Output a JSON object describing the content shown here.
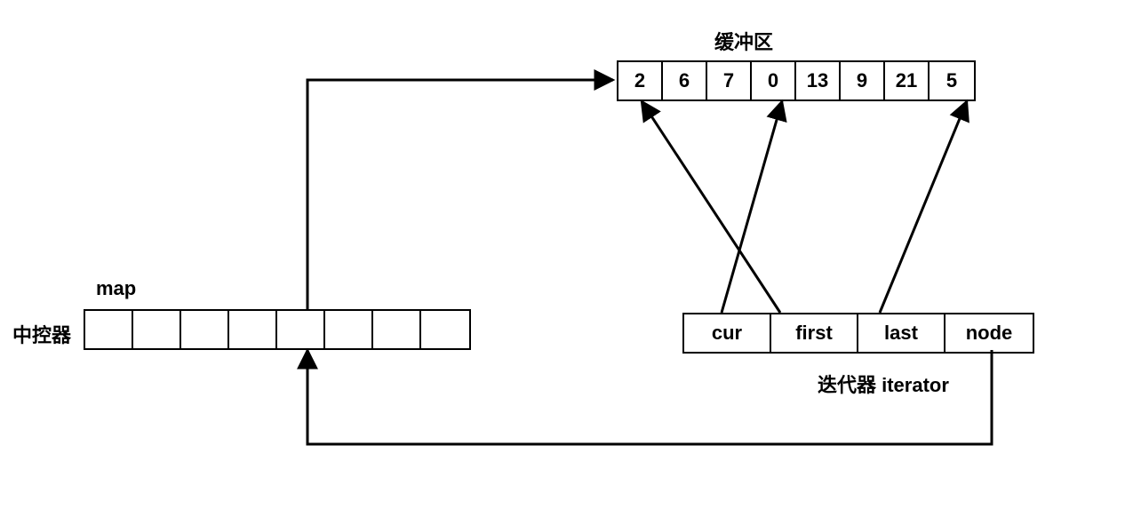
{
  "labels": {
    "buffer_title": "缓冲区",
    "map_title": "map",
    "controller": "中控器",
    "iterator_title": "迭代器 iterator"
  },
  "buffer": {
    "values": [
      "2",
      "6",
      "7",
      "0",
      "13",
      "9",
      "21",
      "5"
    ]
  },
  "map": {
    "cell_count": 8
  },
  "iterator": {
    "fields": [
      "cur",
      "first",
      "last",
      "node"
    ]
  }
}
